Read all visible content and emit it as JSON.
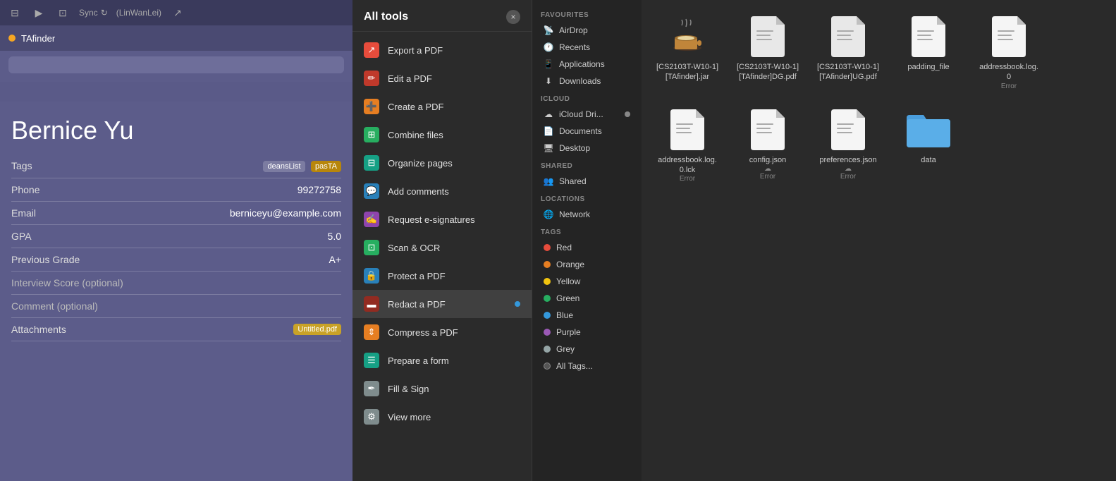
{
  "tafinder": {
    "title": "TAfinder",
    "toolbar": {
      "sync_label": "Sync",
      "linwanlei_label": "(LinWanLei)"
    },
    "person": {
      "name": "Bernice Yu",
      "tags_label": "Tags",
      "tags": [
        "deansList",
        "pasTA"
      ],
      "phone_label": "Phone",
      "phone": "99272758",
      "email_label": "Email",
      "email": "berniceyu@example.com",
      "gpa_label": "GPA",
      "gpa": "5.0",
      "prev_grade_label": "Previous Grade",
      "prev_grade": "A+",
      "interview_label": "Interview Score (optional)",
      "comment_label": "Comment (optional)",
      "attachments_label": "Attachments",
      "attachment_file": "Untitled.pdf"
    }
  },
  "tools_panel": {
    "title": "All tools",
    "close_label": "×",
    "tools": [
      {
        "id": "export-pdf",
        "label": "Export a PDF",
        "icon_color": "red",
        "icon": "↗"
      },
      {
        "id": "edit-pdf",
        "label": "Edit a PDF",
        "icon_color": "pink",
        "icon": "✏"
      },
      {
        "id": "create-pdf",
        "label": "Create a PDF",
        "icon_color": "orange",
        "icon": "+"
      },
      {
        "id": "combine-files",
        "label": "Combine files",
        "icon_color": "green",
        "icon": "⊞"
      },
      {
        "id": "organize-pages",
        "label": "Organize pages",
        "icon_color": "teal",
        "icon": "⊟"
      },
      {
        "id": "add-comments",
        "label": "Add comments",
        "icon_color": "blue",
        "icon": "💬"
      },
      {
        "id": "request-signatures",
        "label": "Request e-signatures",
        "icon_color": "purple",
        "icon": "✍"
      },
      {
        "id": "scan-ocr",
        "label": "Scan & OCR",
        "icon_color": "green",
        "icon": "⊡"
      },
      {
        "id": "protect-pdf",
        "label": "Protect a PDF",
        "icon_color": "blue",
        "icon": "🔒"
      },
      {
        "id": "redact-pdf",
        "label": "Redact a PDF",
        "icon_color": "dark-red",
        "icon": "▬",
        "badge": true
      },
      {
        "id": "compress-pdf",
        "label": "Compress a PDF",
        "icon_color": "orange",
        "icon": "↕"
      },
      {
        "id": "prepare-form",
        "label": "Prepare a form",
        "icon_color": "teal",
        "icon": "☰"
      },
      {
        "id": "fill-sign",
        "label": "Fill & Sign",
        "icon_color": "gray",
        "icon": "✒"
      },
      {
        "id": "view-more",
        "label": "View more",
        "icon_color": "gray",
        "icon": "⚙"
      }
    ]
  },
  "finder": {
    "sidebar": {
      "favourites_label": "Favourites",
      "items_favourites": [
        {
          "id": "airdrop",
          "label": "AirDrop",
          "icon": "📡"
        },
        {
          "id": "recents",
          "label": "Recents",
          "icon": "🕐"
        },
        {
          "id": "applications",
          "label": "Applications",
          "icon": "📱"
        },
        {
          "id": "downloads",
          "label": "Downloads",
          "icon": "⬇"
        }
      ],
      "icloud_label": "iCloud",
      "items_icloud": [
        {
          "id": "icloud-drive",
          "label": "iCloud Dri...",
          "icon": "☁"
        },
        {
          "id": "documents",
          "label": "Documents",
          "icon": "📄"
        },
        {
          "id": "desktop",
          "label": "Desktop",
          "icon": "🖥"
        }
      ],
      "shared_label": "Shared",
      "items_shared": [
        {
          "id": "shared",
          "label": "Shared",
          "icon": "👥"
        }
      ],
      "locations_label": "Locations",
      "items_locations": [
        {
          "id": "network",
          "label": "Network",
          "icon": "🌐"
        }
      ],
      "tags_label": "Tags",
      "tags": [
        {
          "id": "red",
          "label": "Red",
          "color": "#e74c3c"
        },
        {
          "id": "orange",
          "label": "Orange",
          "color": "#e67e22"
        },
        {
          "id": "yellow",
          "label": "Yellow",
          "color": "#f1c40f"
        },
        {
          "id": "green",
          "label": "Green",
          "color": "#27ae60"
        },
        {
          "id": "blue",
          "label": "Blue",
          "color": "#3498db"
        },
        {
          "id": "purple",
          "label": "Purple",
          "color": "#9b59b6"
        },
        {
          "id": "grey",
          "label": "Grey",
          "color": "#95a5a6"
        },
        {
          "id": "all-tags",
          "label": "All Tags...",
          "color": "#555"
        }
      ]
    },
    "files": [
      {
        "id": "file1",
        "name": "[CS2103T-W10-1]\n[TAfinder].jar",
        "type": "jar",
        "icon_type": "coffee"
      },
      {
        "id": "file2",
        "name": "[CS2103T-W10-1]\n[TAfinder]DG.pdf",
        "type": "pdf",
        "icon_type": "doc"
      },
      {
        "id": "file3",
        "name": "[CS2103T-W10-1]\n[TAfinder]UG.pdf",
        "type": "pdf",
        "icon_type": "doc"
      },
      {
        "id": "file4",
        "name": "padding_file",
        "type": "file",
        "icon_type": "doc-white"
      },
      {
        "id": "file5",
        "name": "addressbook.log.\n0",
        "type": "log",
        "icon_type": "doc-white",
        "badge": "Error"
      },
      {
        "id": "file6",
        "name": "addressbook.log.\n0.lck",
        "type": "lck",
        "icon_type": "doc-white",
        "badge": "Error"
      },
      {
        "id": "file7",
        "name": "config.json",
        "type": "json",
        "icon_type": "doc-white",
        "badge": "Error",
        "cloud": true
      },
      {
        "id": "file8",
        "name": "preferences.json",
        "type": "json",
        "icon_type": "doc-white",
        "badge": "Error",
        "cloud": true
      },
      {
        "id": "file9",
        "name": "data",
        "type": "folder",
        "icon_type": "folder"
      }
    ]
  }
}
